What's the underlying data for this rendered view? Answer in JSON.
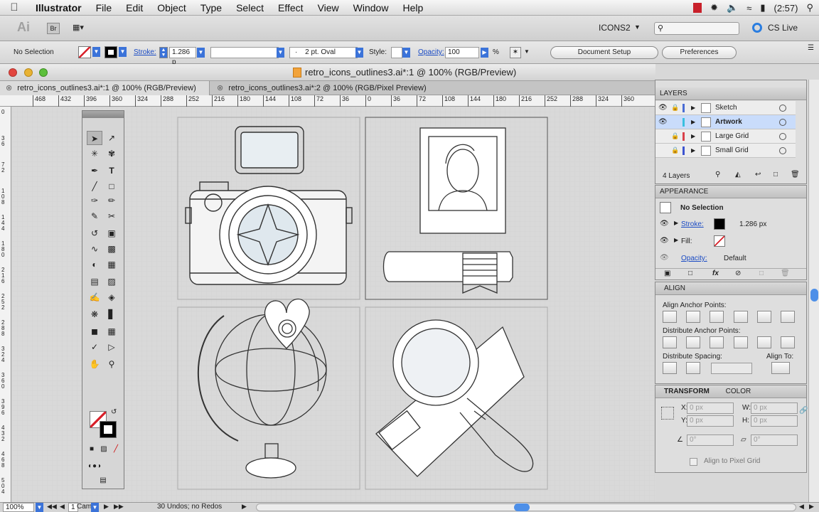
{
  "menubar": {
    "app_name": "Illustrator",
    "items": [
      "File",
      "Edit",
      "Object",
      "Type",
      "Select",
      "Effect",
      "View",
      "Window",
      "Help"
    ],
    "clock": "(2:57)"
  },
  "appbar": {
    "ai_badge": "Ai",
    "br_badge": "Br",
    "workspace": "ICONS2",
    "cs_live": "CS Live"
  },
  "control": {
    "selection": "No Selection",
    "stroke_label": "Stroke:",
    "stroke_value": "1.286 p",
    "brush_value": "2 pt. Oval",
    "brush_prefix": "·",
    "style_label": "Style:",
    "opacity_label": "Opacity:",
    "opacity_value": "100",
    "opacity_unit": "%",
    "doc_setup": "Document Setup",
    "preferences": "Preferences"
  },
  "window": {
    "title": "retro_icons_outlines3.ai*:1 @ 100% (RGB/Preview)",
    "tabs": [
      {
        "label": "retro_icons_outlines3.ai*:1 @ 100% (RGB/Preview)"
      },
      {
        "label": "retro_icons_outlines3.ai*:2 @ 100% (RGB/Pixel Preview)"
      }
    ]
  },
  "ruler": {
    "h_labels": [
      "468",
      "432",
      "396",
      "360",
      "324",
      "288",
      "252",
      "216",
      "180",
      "144",
      "108",
      "72",
      "36",
      "0",
      "36",
      "72",
      "108",
      "144",
      "180",
      "216",
      "252",
      "288",
      "324",
      "360"
    ],
    "v_labels": [
      "0",
      "36",
      "72",
      "108",
      "144",
      "180",
      "216",
      "252",
      "288",
      "324",
      "360",
      "396",
      "432",
      "468",
      "504"
    ]
  },
  "layers": {
    "title": "LAYERS",
    "rows": [
      {
        "name": "Sketch",
        "color": "#4a6cd4",
        "locked": true,
        "visible": true,
        "selected": false
      },
      {
        "name": "Artwork",
        "color": "#39c0e0",
        "locked": false,
        "visible": true,
        "selected": true
      },
      {
        "name": "Large Grid",
        "color": "#d9404a",
        "locked": true,
        "visible": false,
        "selected": false
      },
      {
        "name": "Small Grid",
        "color": "#3d54d0",
        "locked": true,
        "visible": false,
        "selected": false
      }
    ],
    "count": "4 Layers"
  },
  "appearance": {
    "title": "APPEARANCE",
    "selection": "No Selection",
    "stroke_label": "Stroke:",
    "stroke_value": "1.286 px",
    "fill_label": "Fill:",
    "opacity_label": "Opacity:",
    "opacity_value": "Default"
  },
  "align": {
    "title": "ALIGN",
    "anchor_label": "Align Anchor Points:",
    "distribute_label": "Distribute Anchor Points:",
    "spacing_label": "Distribute Spacing:",
    "align_to_label": "Align To:"
  },
  "transform": {
    "title": "TRANSFORM",
    "color_tab": "COLOR",
    "x_label": "X:",
    "x_value": "0 px",
    "y_label": "Y:",
    "y_value": "0 px",
    "w_label": "W:",
    "w_value": "0 px",
    "h_label": "H:",
    "h_value": "0 px",
    "angle_value": "0°",
    "shear_value": "0°",
    "pixel_grid": "Align to Pixel Grid"
  },
  "status": {
    "zoom": "100%",
    "page": "1",
    "art": "Cam",
    "undos": "30 Undos; no Redos"
  }
}
